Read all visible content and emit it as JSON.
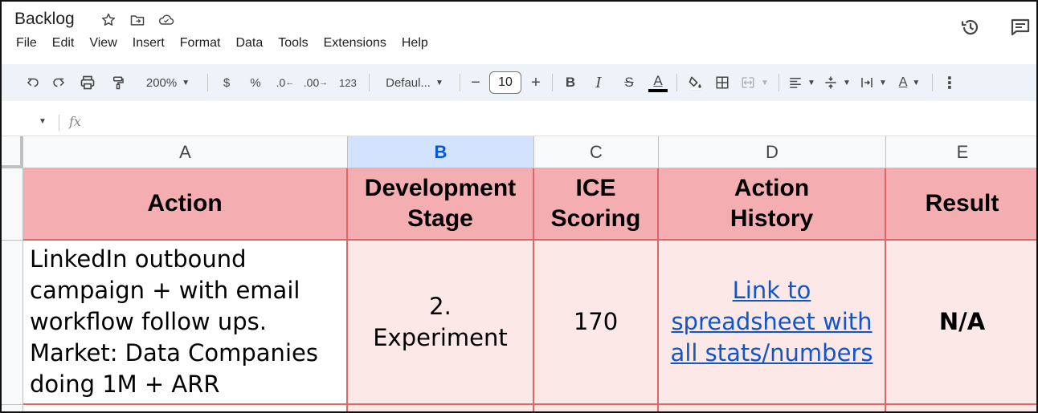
{
  "app": {
    "doc_title": "Backlog",
    "title_icons": [
      "star-icon",
      "move-to-folder-icon",
      "cloud-status-icon"
    ],
    "right_icons": [
      "version-history-icon",
      "comments-icon"
    ]
  },
  "menu": {
    "items": [
      "File",
      "Edit",
      "View",
      "Insert",
      "Format",
      "Data",
      "Tools",
      "Extensions",
      "Help"
    ]
  },
  "toolbar": {
    "zoom": "200%",
    "currency": "$",
    "percent": "%",
    "decrease_decimal": ".0",
    "increase_decimal": ".00",
    "number_format": "123",
    "font": "Defaul...",
    "font_size": "10",
    "decrease_size": "−",
    "increase_size": "+",
    "bold": "B",
    "italic": "I",
    "strikethrough": "S",
    "text_color": "A",
    "text_rotation": "A",
    "more": "⋮",
    "text_color_swatch": "#000000"
  },
  "formula_bar": {
    "fx": "fx"
  },
  "sheet": {
    "columns": [
      "A",
      "B",
      "C",
      "D",
      "E"
    ],
    "selected_column": "B",
    "header_row": {
      "action": "Action",
      "development_stage": "Development\nStage",
      "ice_scoring": "ICE\nScoring",
      "action_history": "Action\nHistory",
      "result": "Result"
    },
    "rows": [
      {
        "action": "LinkedIn outbound\ncampaign + with email\nworkflow follow ups.\n Market: Data Companies\ndoing 1M + ARR",
        "development_stage": "2.\nExperiment",
        "ice_scoring": "170",
        "action_history": "Link to\n spreadsheet with\nall stats/numbers",
        "result": "N/A"
      }
    ],
    "colors": {
      "header_fill": "#f4aeb1",
      "body_fill": "#fce8e6",
      "border": "#e06666",
      "link": "#1155cc"
    }
  }
}
